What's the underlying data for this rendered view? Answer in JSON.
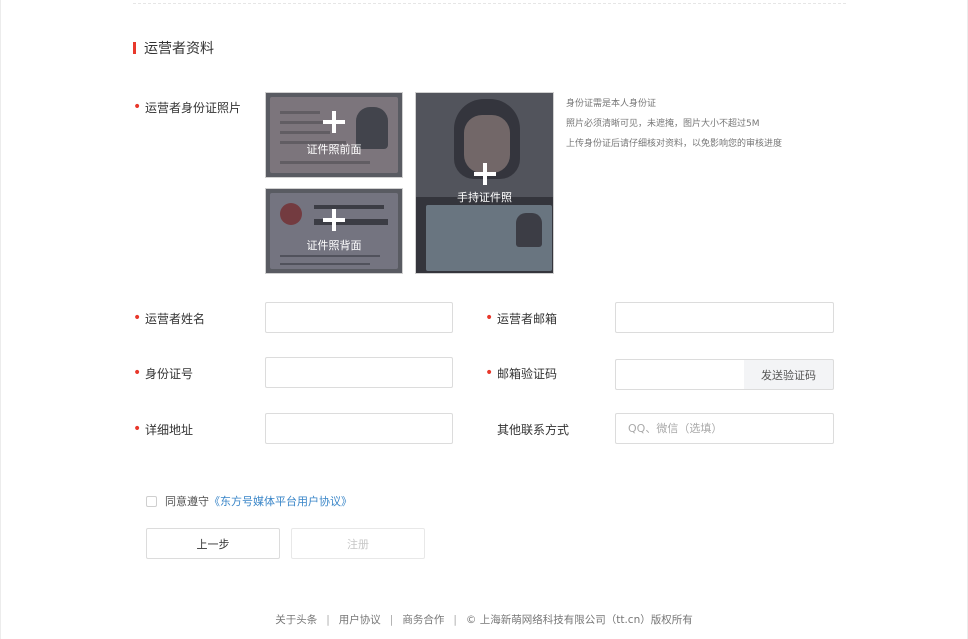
{
  "section_title": "运营者资料",
  "id_photo": {
    "label": "运营者身份证照片",
    "front_caption": "证件照前面",
    "back_caption": "证件照背面",
    "handheld_caption": "手持证件照",
    "hints": [
      "身份证需是本人身份证",
      "照片必须清晰可见，未遮掩，图片大小不超过5M",
      "上传身份证后请仔细核对资料，以免影响您的审核进度"
    ]
  },
  "fields": {
    "name": {
      "label": "运营者姓名",
      "value": "",
      "placeholder": ""
    },
    "email": {
      "label": "运营者邮箱",
      "value": "",
      "placeholder": ""
    },
    "id_number": {
      "label": "身份证号",
      "value": "",
      "placeholder": ""
    },
    "email_code": {
      "label": "邮箱验证码",
      "value": "",
      "placeholder": "",
      "button": "发送验证码"
    },
    "address": {
      "label": "详细地址",
      "value": "",
      "placeholder": ""
    },
    "other_contact": {
      "label": "其他联系方式",
      "value": "",
      "placeholder": "QQ、微信（选填）"
    }
  },
  "agreement": {
    "prefix": "同意遵守",
    "link": "《东方号媒体平台用户协议》",
    "checked": false
  },
  "buttons": {
    "prev": "上一步",
    "register": "注册"
  },
  "footer": {
    "links": [
      "关于头条",
      "用户协议",
      "商务合作"
    ],
    "copyright": "© 上海新萌网络科技有限公司（tt.cn）版权所有"
  },
  "colors": {
    "required_marker": "#e8382b",
    "link": "#3a86c8"
  }
}
